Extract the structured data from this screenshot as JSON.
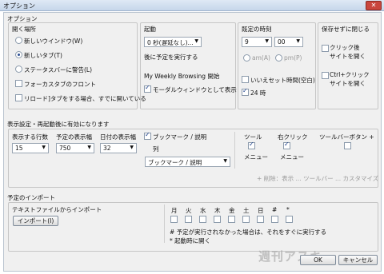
{
  "window": {
    "title": "オプション",
    "close": "✕"
  },
  "options": {
    "heading": "オプション",
    "open_location": {
      "title": "開く場所",
      "items": [
        "新しいウインドウ(W)",
        "新しいタブ(T)",
        "ステータスバーに警告(L)"
      ],
      "selected": 1
    },
    "focus_tab": "フォーカスタブのフロント",
    "reload_tab": "リロード]タブをする場合、すでに開いている",
    "activation": {
      "title": "起動",
      "select": "0 秒(遅延なし)...",
      "note": "後に予定を実行する"
    },
    "weekly": "My Weekly Browsing 開始",
    "modal": "モーダルウィンドウとして表示",
    "time": {
      "title": "既定の時刻",
      "hour": "9",
      "minute": "00",
      "am": "am(A)",
      "pm": "pm(P)",
      "reset": "いいえセット時間(空白)",
      "h24": "24 時"
    },
    "close_save": {
      "title": "保存せずに閉じる",
      "click": "クリック後\nサイトを開く",
      "ctrl": "Ctrl+クリック\nサイトを開く"
    }
  },
  "display": {
    "heading": "表示設定・再起動後に有効になります",
    "rows": {
      "label": "表示する行数",
      "value": "15"
    },
    "width": {
      "label": "予定の表示幅",
      "value": "750"
    },
    "date_width": {
      "label": "日付の表示幅",
      "value": "32"
    },
    "bookmark": {
      "label": "ブックマーク / 説明",
      "sub": "列",
      "select": "ブックマーク / 説明"
    },
    "columns": [
      {
        "h": "ツール",
        "m": "メニュー"
      },
      {
        "h": "右クリック",
        "m": "メニュー"
      },
      {
        "h": "ツールバーボタン +",
        "m": ""
      }
    ],
    "footer": "+ 削除：表示 ... ツールバー ... カスタマイズ"
  },
  "import": {
    "heading": "予定のインポート",
    "text_label": "テキストファイルからインポート",
    "button": "インポート(I)",
    "days": [
      "月",
      "火",
      "水",
      "木",
      "金",
      "土",
      "日",
      "#",
      "*"
    ],
    "note1": "# 予定が実行されなかった場合は、それをすぐに実行する",
    "note2": "* 起動時に開く"
  },
  "watermark": "週刊アスキー",
  "buttons": {
    "ok": "OK",
    "cancel": "キャンセル"
  }
}
